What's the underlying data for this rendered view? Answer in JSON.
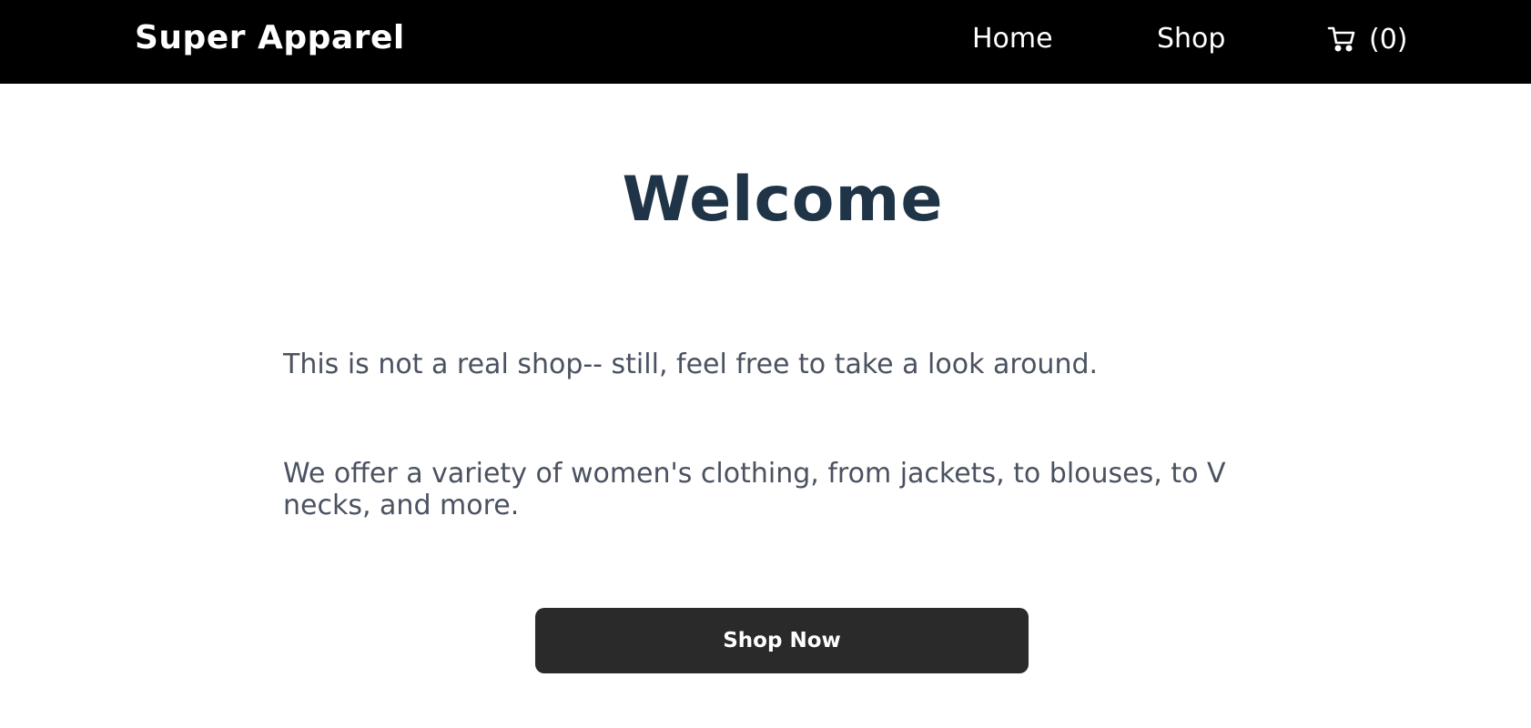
{
  "header": {
    "brand": "Super Apparel",
    "nav": {
      "home_label": "Home",
      "shop_label": "Shop",
      "cart_count": "(0)",
      "cart_icon": "shopping-cart-icon"
    }
  },
  "main": {
    "title": "Welcome",
    "paragraphs": [
      "This is not a real shop-- still, feel free to take a look around.",
      "We offer a variety of women's clothing, from jackets, to blouses, to V necks, and more."
    ],
    "cta_label": "Shop Now"
  },
  "colors": {
    "nav_background": "#000000",
    "title_color": "#1f3447",
    "text_color": "#4a5260",
    "button_background": "#2a2a2a"
  }
}
